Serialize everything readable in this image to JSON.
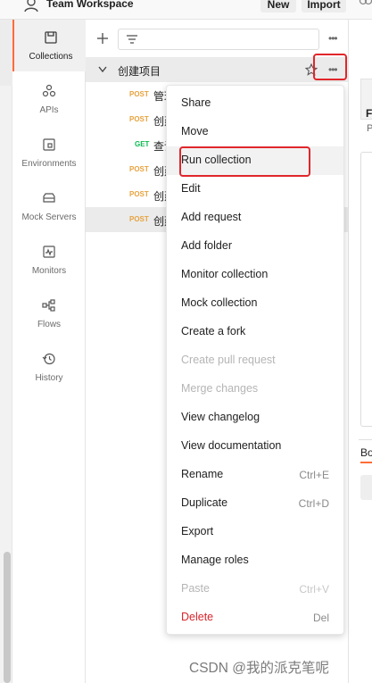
{
  "header": {
    "workspace_title": "Team Workspace",
    "new_label": "New",
    "import_label": "Import"
  },
  "nav": {
    "items": [
      {
        "label": "Collections",
        "icon": "collections-icon",
        "active": true
      },
      {
        "label": "APIs",
        "icon": "apis-icon"
      },
      {
        "label": "Environments",
        "icon": "environments-icon"
      },
      {
        "label": "Mock Servers",
        "icon": "mock-servers-icon"
      },
      {
        "label": "Monitors",
        "icon": "monitors-icon"
      },
      {
        "label": "Flows",
        "icon": "flows-icon"
      },
      {
        "label": "History",
        "icon": "history-icon"
      }
    ]
  },
  "sidebar": {
    "more_label": "•••",
    "collection": {
      "name": "创建项目",
      "more_label": "•••"
    },
    "requests": [
      {
        "method": "POST",
        "name": "管理"
      },
      {
        "method": "POST",
        "name": "创建"
      },
      {
        "method": "GET",
        "name": "查询"
      },
      {
        "method": "POST",
        "name": "创建"
      },
      {
        "method": "POST",
        "name": "创建"
      },
      {
        "method": "POST",
        "name": "创建"
      }
    ]
  },
  "context_menu": {
    "items": [
      {
        "label": "Share"
      },
      {
        "label": "Move"
      },
      {
        "label": "Run collection",
        "highlighted": true
      },
      {
        "label": "Edit"
      },
      {
        "label": "Add request"
      },
      {
        "label": "Add folder"
      },
      {
        "label": "Monitor collection"
      },
      {
        "label": "Mock collection"
      },
      {
        "label": "Create a fork"
      },
      {
        "label": "Create pull request",
        "disabled": true
      },
      {
        "label": "Merge changes",
        "disabled": true
      },
      {
        "label": "View changelog"
      },
      {
        "label": "View documentation"
      },
      {
        "label": "Rename",
        "shortcut": "Ctrl+E"
      },
      {
        "label": "Duplicate",
        "shortcut": "Ctrl+D"
      },
      {
        "label": "Export"
      },
      {
        "label": "Manage roles"
      },
      {
        "label": "Paste",
        "shortcut": "Ctrl+V",
        "disabled": true
      },
      {
        "label": "Delete",
        "shortcut": "Del",
        "danger": true
      }
    ]
  },
  "right_panel": {
    "tab_letter": "F",
    "p_letter": "P",
    "bo_label": "Bo"
  },
  "watermark": "CSDN @我的派克笔呢",
  "colors": {
    "accent": "#ff6c37",
    "highlight_box": "#e0262b",
    "post": "#e7a33e",
    "get": "#0cbb52",
    "delete": "#d9252b"
  }
}
